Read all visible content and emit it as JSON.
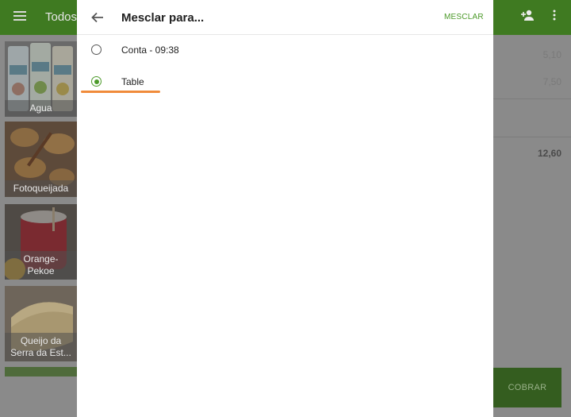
{
  "background": {
    "title": "Todos",
    "tiles": [
      {
        "label": "Agua"
      },
      {
        "label": "Fotoqueijada"
      },
      {
        "label": "Orange-\nPekoe"
      },
      {
        "label": "Queijo da\nSerra da Est..."
      }
    ],
    "amounts": [
      "5,10",
      "7,50"
    ],
    "total": "12,60",
    "charge_label": "COBRAR"
  },
  "dialog": {
    "title": "Mesclar para...",
    "merge_label": "MESCLAR",
    "options": [
      {
        "label": "Conta - 09:38",
        "selected": false
      },
      {
        "label": "Table",
        "selected": true
      }
    ]
  },
  "colors": {
    "accent": "#4c9a2a",
    "appbar": "#3f7a21",
    "focus": "#f08b3a"
  }
}
